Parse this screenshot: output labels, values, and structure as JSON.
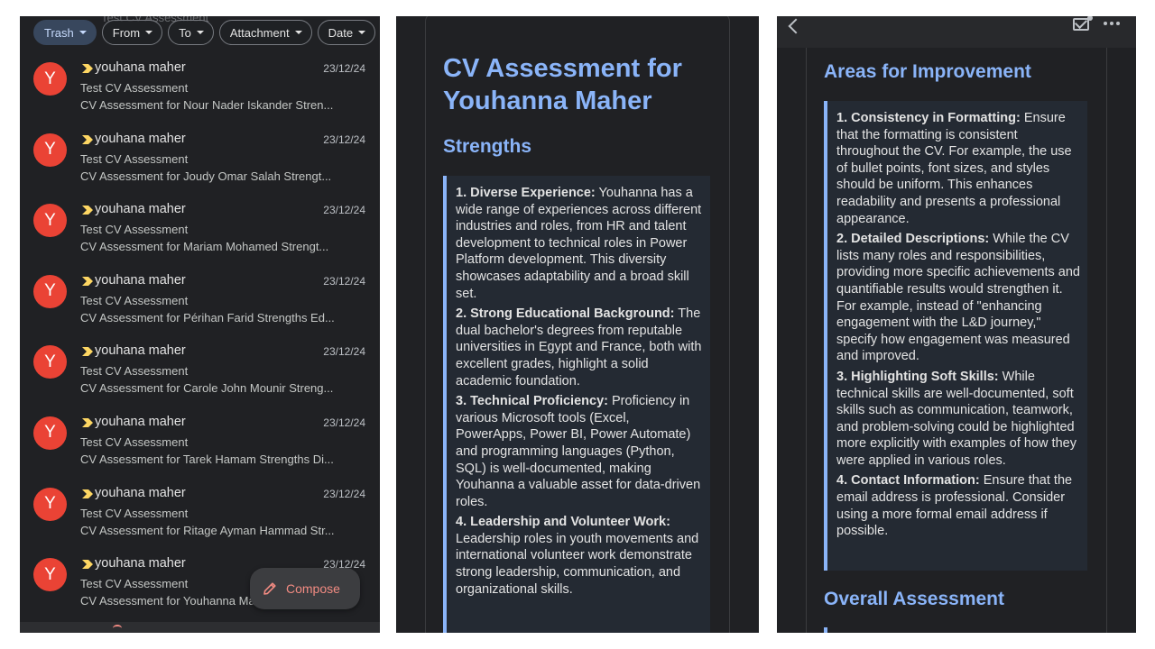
{
  "filters": [
    {
      "label": "Trash",
      "active": true
    },
    {
      "label": "From",
      "active": false
    },
    {
      "label": "To",
      "active": false
    },
    {
      "label": "Attachment",
      "active": false
    },
    {
      "label": "Date",
      "active": false
    }
  ],
  "ghost_row": "Test CV Assessment",
  "emails": [
    {
      "avatar": "Y",
      "sender": "youhana maher",
      "date": "23/12/24",
      "subject": "Test CV Assessment",
      "snippet": "CV Assessment for Nour Nader Iskander Stren..."
    },
    {
      "avatar": "Y",
      "sender": "youhana maher",
      "date": "23/12/24",
      "subject": "Test CV Assessment",
      "snippet": "CV Assessment for Joudy Omar Salah Strengt..."
    },
    {
      "avatar": "Y",
      "sender": "youhana maher",
      "date": "23/12/24",
      "subject": "Test CV Assessment",
      "snippet": "CV Assessment for Mariam Mohamed Strengt..."
    },
    {
      "avatar": "Y",
      "sender": "youhana maher",
      "date": "23/12/24",
      "subject": "Test CV Assessment",
      "snippet": "CV Assessment for Périhan Farid Strengths Ed..."
    },
    {
      "avatar": "Y",
      "sender": "youhana maher",
      "date": "23/12/24",
      "subject": "Test CV Assessment",
      "snippet": "CV Assessment for Carole John Mounir Streng..."
    },
    {
      "avatar": "Y",
      "sender": "youhana maher",
      "date": "23/12/24",
      "subject": "Test CV Assessment",
      "snippet": "CV Assessment for Tarek Hamam Strengths Di..."
    },
    {
      "avatar": "Y",
      "sender": "youhana maher",
      "date": "23/12/24",
      "subject": "Test CV Assessment",
      "snippet": "CV Assessment for Ritage Ayman Hammad Str..."
    },
    {
      "avatar": "Y",
      "sender": "youhana maher",
      "date": "23/12/24",
      "subject": "Test CV Assessment",
      "snippet": "CV Assessment for Youhanna Maher"
    }
  ],
  "compose_label": "Compose",
  "assessment": {
    "title": "CV Assessment for Youhanna Maher",
    "strengths_heading": "Strengths",
    "strengths": [
      {
        "title": "1. Diverse Experience:",
        "text": "Youhanna has a wide range of experiences across different industries and roles, from HR and talent development to technical roles in Power Platform development. This diversity showcases adaptability and a broad skill set."
      },
      {
        "title": "2. Strong Educational Background:",
        "text": "The dual bachelor's degrees from reputable universities in Egypt and France, both with excellent grades, highlight a solid academic foundation."
      },
      {
        "title": "3. Technical Proficiency:",
        "text": "Proficiency in various Microsoft tools (Excel, PowerApps, Power BI, Power Automate) and programming languages (Python, SQL) is well-documented, making Youhanna a valuable asset for data-driven roles."
      },
      {
        "title": "4. Leadership and Volunteer Work:",
        "text": "Leadership roles in youth movements and international volunteer work demonstrate strong leadership, communication, and organizational skills."
      }
    ],
    "improvement_heading": "Areas for Improvement",
    "improvements": [
      {
        "title": "1. Consistency in Formatting:",
        "text": "Ensure that the formatting is consistent throughout the CV. For example, the use of bullet points, font sizes, and styles should be uniform. This enhances readability and presents a professional appearance."
      },
      {
        "title": "2. Detailed Descriptions:",
        "text": "While the CV lists many roles and responsibilities, providing more specific achievements and quantifiable results would strengthen it. For example, instead of \"enhancing engagement with the L&D journey,\" specify how engagement was measured and improved."
      },
      {
        "title": "3. Highlighting Soft Skills:",
        "text": "While technical skills are well-documented, soft skills such as communication, teamwork, and problem-solving could be highlighted more explicitly with examples of how they were applied in various roles."
      },
      {
        "title": "4. Contact Information:",
        "text": "Ensure that the email address is professional. Consider using a more formal email address if possible."
      }
    ],
    "overall_heading": "Overall Assessment"
  },
  "colors": {
    "accent_blue": "#8ab4f8",
    "avatar_red": "#ea4335",
    "importance_yellow": "#fdd663",
    "compose_text": "#f28b82",
    "background": "#202124"
  },
  "icons": {
    "importance": "importance-marker-icon",
    "compose": "pencil-icon",
    "back": "back-arrow-icon",
    "mail": "mark-unread-icon",
    "more": "more-options-icon"
  }
}
